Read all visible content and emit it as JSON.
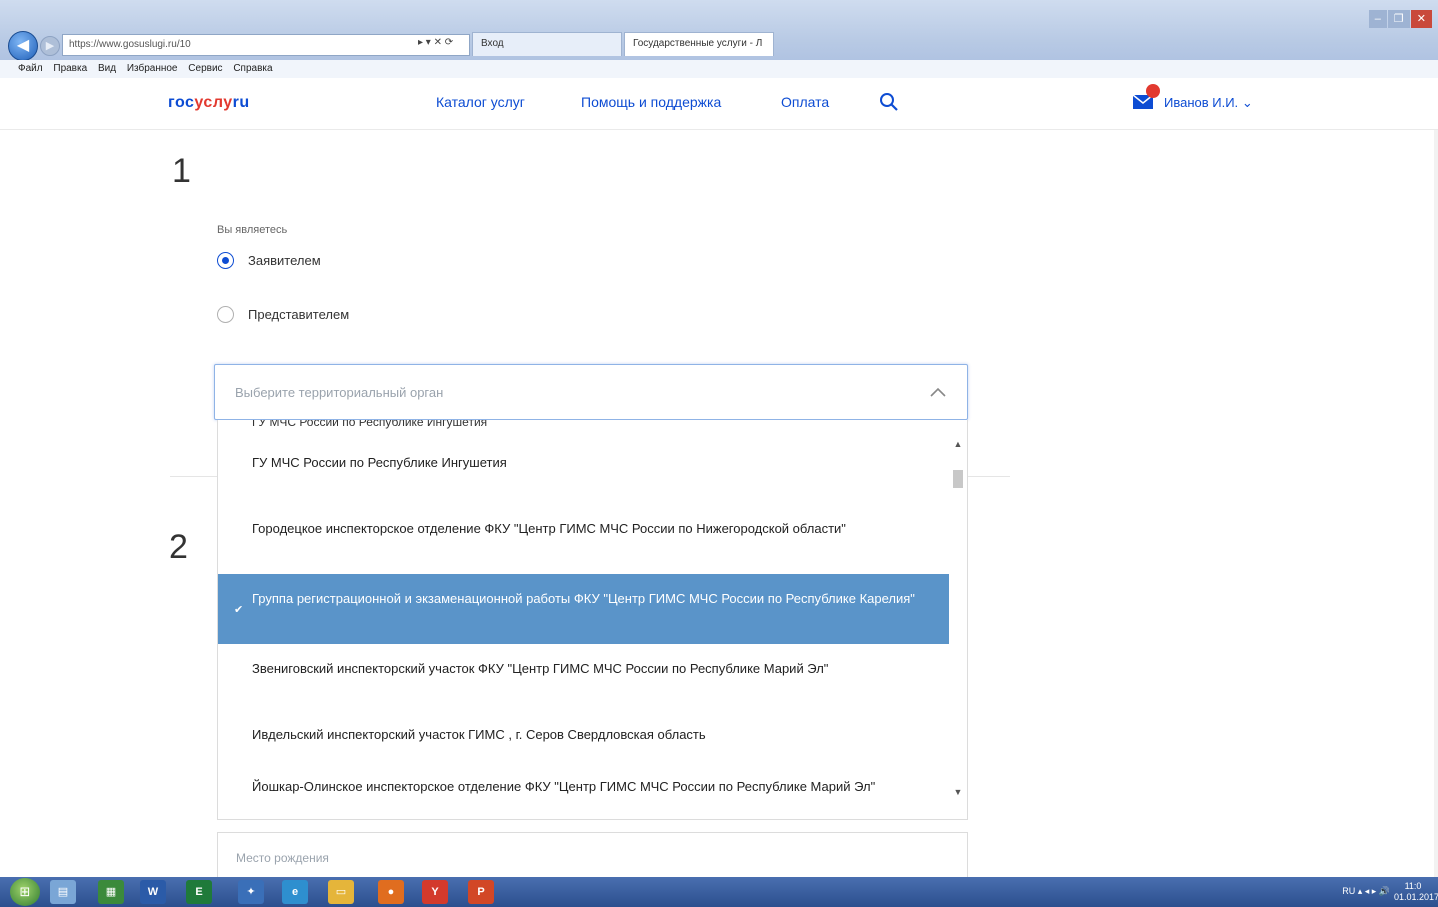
{
  "browser": {
    "address": "https://www.gosuslugi.ru/10",
    "address_tools": "▸ ▾ ✕ ⟳",
    "tabs": [
      "Вход",
      "Государственные услуги - Л"
    ],
    "window_buttons": [
      "–",
      "❐",
      "✕"
    ],
    "menu": [
      "Файл",
      "Правка",
      "Вид",
      "Избранное",
      "Сервис",
      "Справка"
    ]
  },
  "header": {
    "logo_gos": "гос",
    "logo_usl": "услу",
    "logo_ru": "ru",
    "nav": [
      "Каталог услуг",
      "Помощь и поддержка",
      "Оплата"
    ],
    "user": "Иванов И.И.",
    "icons": {
      "search": "search-icon",
      "mail": "mail-icon"
    },
    "colors": {
      "brand_blue": "#0d4cd3",
      "brand_red": "#e2392f"
    }
  },
  "form": {
    "step1": "1",
    "step2": "2",
    "role_label": "Вы являетесь",
    "roles": [
      {
        "label": "Заявителем",
        "selected": true
      },
      {
        "label": "Представителем",
        "selected": false
      }
    ],
    "territorial_placeholder": "Выберите территориальный орган",
    "options_cut_top": "ГУ МЧС России по Республике Ингушетия",
    "options": [
      {
        "label": "ГУ МЧС России по Республике Ингушетия",
        "selected": false
      },
      {
        "label": "Городецкое инспекторское отделение ФКУ \"Центр ГИМС МЧС России по Нижегородской области\"",
        "selected": false
      },
      {
        "label": "Группа регистрационной и экзаменационной работы ФКУ \"Центр ГИМС МЧС России по Республике Карелия\"",
        "selected": true
      },
      {
        "label": "Звениговский инспекторский участок ФКУ \"Центр ГИМС МЧС России по Республике Марий Эл\"",
        "selected": false
      },
      {
        "label": "Ивдельский инспекторский участок ГИМС , г. Серов Свердловская область",
        "selected": false
      },
      {
        "label": "Йошкар-Олинское инспекторское отделение ФКУ \"Центр ГИМС МЧС России по Республике Марий Эл\"",
        "selected": false
      }
    ],
    "selected_accent": "#5a94c9",
    "birthplace_placeholder": "Место рождения"
  },
  "taskbar": {
    "apps": [
      "W",
      "E",
      "P"
    ],
    "tray": "RU ▴ ◂ ▸ 🔊",
    "time": "11:0",
    "date": "01.01.2017"
  }
}
